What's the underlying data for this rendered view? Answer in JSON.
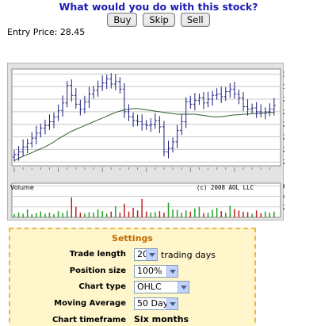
{
  "question": "What would you do with this stock?",
  "actions": {
    "buy": "Buy",
    "skip": "Skip",
    "sell": "Sell"
  },
  "entry": {
    "label": "Entry Price:",
    "value": "28.45"
  },
  "chart": {
    "price_ticks": [
      "31",
      "30",
      "29",
      "28",
      "27",
      "26",
      "25",
      "24"
    ],
    "volume_label": "Volume",
    "copyright": "(c) 2008 AOL LLC",
    "volume_ticks": [
      "600 K",
      "400",
      "200"
    ]
  },
  "chart_data": {
    "type": "ohlc",
    "ylim": [
      24,
      31
    ],
    "moving_average_label": "50 Day",
    "close": [
      24.6,
      24.8,
      25.2,
      25.5,
      25.9,
      26.3,
      26.7,
      26.9,
      27.2,
      27.6,
      28.1,
      28.7,
      30.1,
      29.3,
      28.6,
      28.2,
      28.8,
      29.4,
      29.7,
      30.0,
      30.3,
      30.6,
      30.2,
      30.4,
      29.8,
      28.0,
      27.6,
      27.3,
      27.2,
      27.0,
      26.9,
      27.0,
      27.3,
      26.8,
      24.8,
      25.1,
      25.6,
      26.5,
      27.2,
      28.8,
      28.6,
      28.9,
      29.1,
      28.7,
      29.0,
      29.3,
      29.4,
      29.2,
      29.6,
      29.8,
      29.4,
      29.1,
      28.4,
      28.2,
      28.3,
      28.0,
      27.9,
      28.0,
      28.2,
      28.5
    ],
    "ma": [
      24.1,
      24.3,
      24.45,
      24.6,
      24.75,
      24.9,
      25.05,
      25.2,
      25.4,
      25.6,
      25.85,
      26.05,
      26.25,
      26.45,
      26.6,
      26.75,
      26.9,
      27.05,
      27.2,
      27.35,
      27.5,
      27.65,
      27.8,
      27.95,
      28.05,
      28.15,
      28.2,
      28.25,
      28.25,
      28.2,
      28.15,
      28.1,
      28.05,
      28.0,
      27.95,
      27.9,
      27.85,
      27.8,
      27.8,
      27.8,
      27.8,
      27.8,
      27.75,
      27.7,
      27.65,
      27.6,
      27.6,
      27.6,
      27.65,
      27.7,
      27.75,
      27.75,
      27.8,
      27.8,
      27.85,
      27.85,
      27.9,
      27.9,
      27.95,
      27.95
    ],
    "volume_k": [
      60,
      90,
      70,
      150,
      60,
      80,
      110,
      70,
      90,
      60,
      120,
      85,
      130,
      380,
      200,
      90,
      70,
      100,
      90,
      150,
      120,
      70,
      110,
      210,
      90,
      260,
      110,
      180,
      130,
      350,
      110,
      90,
      100,
      120,
      90,
      280,
      150,
      140,
      90,
      130,
      110,
      170,
      200,
      80,
      90,
      140,
      180,
      120,
      90,
      220,
      160,
      130,
      110,
      100,
      70,
      130,
      80,
      110,
      90,
      110
    ]
  },
  "settings": {
    "title": "Settings",
    "trade_length": {
      "label": "Trade length",
      "value": "20",
      "suffix": "trading days"
    },
    "position_size": {
      "label": "Position size",
      "value": "100%"
    },
    "chart_type": {
      "label": "Chart type",
      "value": "OHLC"
    },
    "moving_average": {
      "label": "Moving Average",
      "value": "50 Day"
    },
    "chart_timeframe": {
      "label": "Chart timeframe",
      "value": "Six months"
    }
  }
}
